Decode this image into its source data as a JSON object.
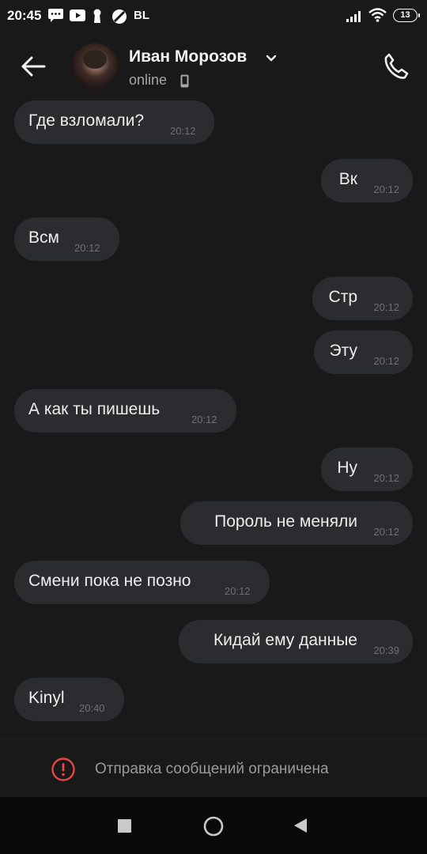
{
  "status_bar": {
    "time": "20:45",
    "carrier_badge": "BL",
    "battery_level": "13",
    "icons": [
      "chat-bubble-icon",
      "youtube-icon",
      "keyhole-icon",
      "blocked-icon",
      "signal-icon",
      "wifi-icon",
      "battery-icon"
    ]
  },
  "header": {
    "name": "Иван Морозов",
    "status": "online",
    "icons": [
      "back-arrow-icon",
      "chevron-down-icon",
      "mobile-device-icon",
      "phone-call-icon"
    ]
  },
  "messages": [
    {
      "text": "Где взломали?",
      "time": "20:12",
      "direction": "in"
    },
    {
      "text": "Вк",
      "time": "20:12",
      "direction": "out"
    },
    {
      "text": "Всм",
      "time": "20:12",
      "direction": "in"
    },
    {
      "text": "Стр",
      "time": "20:12",
      "direction": "out"
    },
    {
      "text": "Эту",
      "time": "20:12",
      "direction": "out"
    },
    {
      "text": "А как ты пишешь",
      "time": "20:12",
      "direction": "in"
    },
    {
      "text": "Ну",
      "time": "20:12",
      "direction": "out"
    },
    {
      "text": "Пороль не меняли",
      "time": "20:12",
      "direction": "out"
    },
    {
      "text": "Смени пока не позно",
      "time": "20:12",
      "direction": "in"
    },
    {
      "text": "Кидай ему данные",
      "time": "20:39",
      "direction": "out"
    },
    {
      "text": "Kinyl",
      "time": "20:40",
      "direction": "in"
    }
  ],
  "restriction": {
    "text": "Отправка сообщений ограничена",
    "icon": "warning-circle-icon"
  },
  "colors": {
    "background": "#19191a",
    "bubble": "#2b2c2f",
    "warning": "#e64646",
    "nav_bar": "#0a0a0a"
  }
}
